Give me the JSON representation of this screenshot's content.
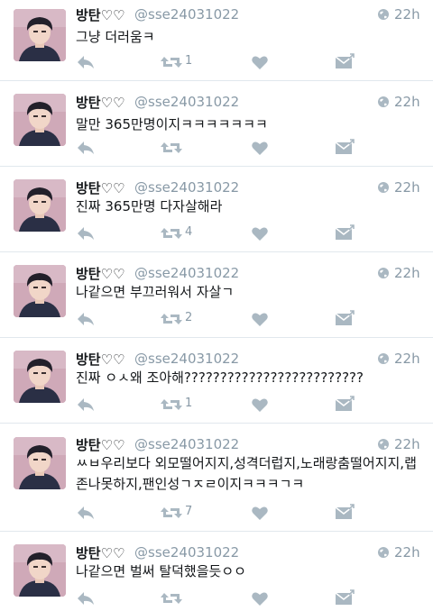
{
  "colors": {
    "accent": "#8899a6",
    "text": "#14171a",
    "divider": "#e1e8ed"
  },
  "icons": {
    "reply": "reply-icon",
    "retweet": "retweet-icon",
    "like": "heart-icon",
    "message": "envelope-icon",
    "visibility": "globe-icon"
  },
  "tweets": [
    {
      "name": "방탄♡♡",
      "handle": "@sse24031022",
      "time": "22h",
      "text": "그냥 더러움ㅋ",
      "retweets": "1"
    },
    {
      "name": "방탄♡♡",
      "handle": "@sse24031022",
      "time": "22h",
      "text": "말만 365만명이지ㅋㅋㅋㅋㅋㅋㅋ",
      "retweets": ""
    },
    {
      "name": "방탄♡♡",
      "handle": "@sse24031022",
      "time": "22h",
      "text": "진짜 365만명 다자살해라",
      "retweets": "4"
    },
    {
      "name": "방탄♡♡",
      "handle": "@sse24031022",
      "time": "22h",
      "text": "나같으면 부끄러워서 자살ㄱ",
      "retweets": "2"
    },
    {
      "name": "방탄♡♡",
      "handle": "@sse24031022",
      "time": "22h",
      "text": "진짜 ㅇㅅ왜 조아해?????????????????????????",
      "retweets": "1"
    },
    {
      "name": "방탄♡♡",
      "handle": "@sse24031022",
      "time": "22h",
      "text": "ㅆㅂ우리보다 외모떨어지지,성격더럽지,노래랑춤떨어지지,랩존나못하지,팬인성ㄱㅈㄹ이지ㅋㅋㅋㄱㅋ",
      "retweets": "7"
    },
    {
      "name": "방탄♡♡",
      "handle": "@sse24031022",
      "time": "22h",
      "text": "나같으면 벌써 탈덕했을듯ㅇㅇ",
      "retweets": ""
    }
  ]
}
